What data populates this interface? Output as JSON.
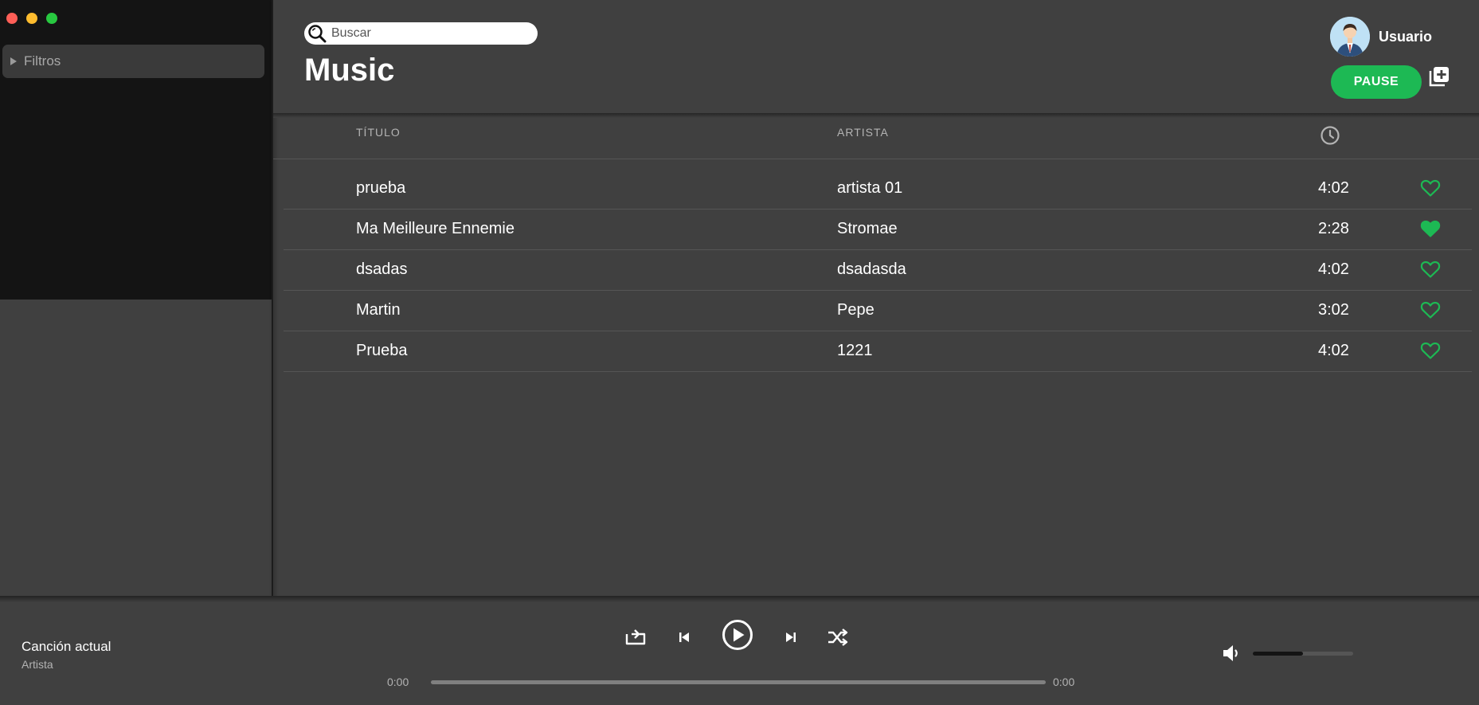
{
  "sidebar": {
    "filters_label": "Filtros"
  },
  "header": {
    "search_placeholder": "Buscar",
    "title": "Music",
    "user_name": "Usuario",
    "pause_label": "PAUSE"
  },
  "table": {
    "columns": {
      "title": "TÍTULO",
      "artist": "ARTISTA"
    },
    "rows": [
      {
        "title": "prueba",
        "artist": "artista 01",
        "duration": "4:02",
        "favorite": false
      },
      {
        "title": "Ma Meilleure Ennemie",
        "artist": "Stromae",
        "duration": "2:28",
        "favorite": true
      },
      {
        "title": "dsadas",
        "artist": "dsadasda",
        "duration": "4:02",
        "favorite": false
      },
      {
        "title": "Martin",
        "artist": "Pepe",
        "duration": "3:02",
        "favorite": false
      },
      {
        "title": "Prueba",
        "artist": "1221",
        "duration": "4:02",
        "favorite": false
      }
    ]
  },
  "player": {
    "track_title": "Canción actual",
    "track_artist": "Artista",
    "elapsed": "0:00",
    "total": "0:00",
    "progress": 0,
    "volume": 0.5
  },
  "colors": {
    "accent": "#1db954",
    "background": "#404040",
    "sidebar": "#141414"
  },
  "icons": [
    "search-icon",
    "clock-icon",
    "heart-icon",
    "heart-filled-icon",
    "add-playlist-icon",
    "repeat-icon",
    "previous-icon",
    "play-icon",
    "next-icon",
    "shuffle-icon",
    "volume-icon"
  ]
}
